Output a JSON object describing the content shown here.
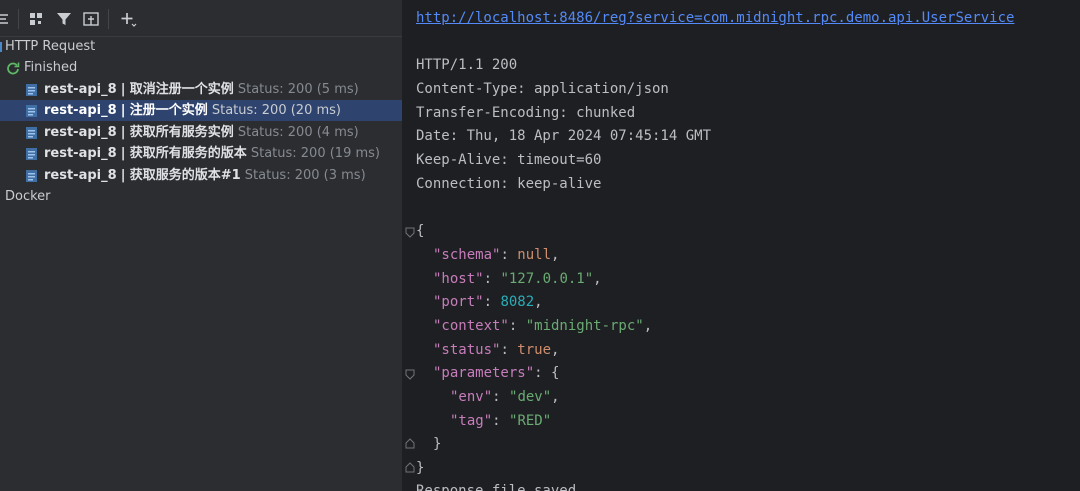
{
  "toolbar": {
    "icons": [
      "sort-icon",
      "group-icon",
      "filter-icon",
      "pin-icon",
      "add-icon"
    ]
  },
  "tree": {
    "root_label": "HTTP Request",
    "finished_label": "Finished",
    "requests": [
      {
        "name": "rest-api_8",
        "sep": "|",
        "title": "取消注册一个实例",
        "status": "Status: 200 (5 ms)"
      },
      {
        "name": "rest-api_8",
        "sep": "|",
        "title": "注册一个实例",
        "status": "Status: 200 (20 ms)"
      },
      {
        "name": "rest-api_8",
        "sep": "|",
        "title": "获取所有服务实例",
        "status": "Status: 200 (4 ms)"
      },
      {
        "name": "rest-api_8",
        "sep": "|",
        "title": "获取所有服务的版本",
        "status": "Status: 200 (19 ms)"
      },
      {
        "name": "rest-api_8",
        "sep": "|",
        "title": "获取服务的版本#1",
        "status": "Status: 200 (3 ms)"
      }
    ],
    "docker_label": "Docker"
  },
  "response": {
    "url": "http://localhost:8486/reg?service=com.midnight.rpc.demo.api.UserService",
    "headers": [
      "HTTP/1.1 200",
      "Content-Type: application/json",
      "Transfer-Encoding: chunked",
      "Date: Thu, 18 Apr 2024 07:45:14 GMT",
      "Keep-Alive: timeout=60",
      "Connection: keep-alive"
    ],
    "json": {
      "open_brace": "{",
      "schema_key": "\"schema\"",
      "schema_val": "null",
      "host_key": "\"host\"",
      "host_val": "\"127.0.0.1\"",
      "port_key": "\"port\"",
      "port_val": "8082",
      "context_key": "\"context\"",
      "context_val": "\"midnight-rpc\"",
      "status_key": "\"status\"",
      "status_val": "true",
      "parameters_key": "\"parameters\"",
      "env_key": "\"env\"",
      "env_val": "\"dev\"",
      "tag_key": "\"tag\"",
      "tag_val": "\"RED\"",
      "inner_close": "}",
      "close_brace": "}"
    },
    "footer": "Response file saved."
  },
  "colors": {
    "selected_row": "#2e436e",
    "url": "#548af7",
    "json_key": "#c77dbb",
    "json_string": "#6aab73",
    "json_keyword": "#cf8e6d",
    "json_number": "#2aacb8"
  }
}
